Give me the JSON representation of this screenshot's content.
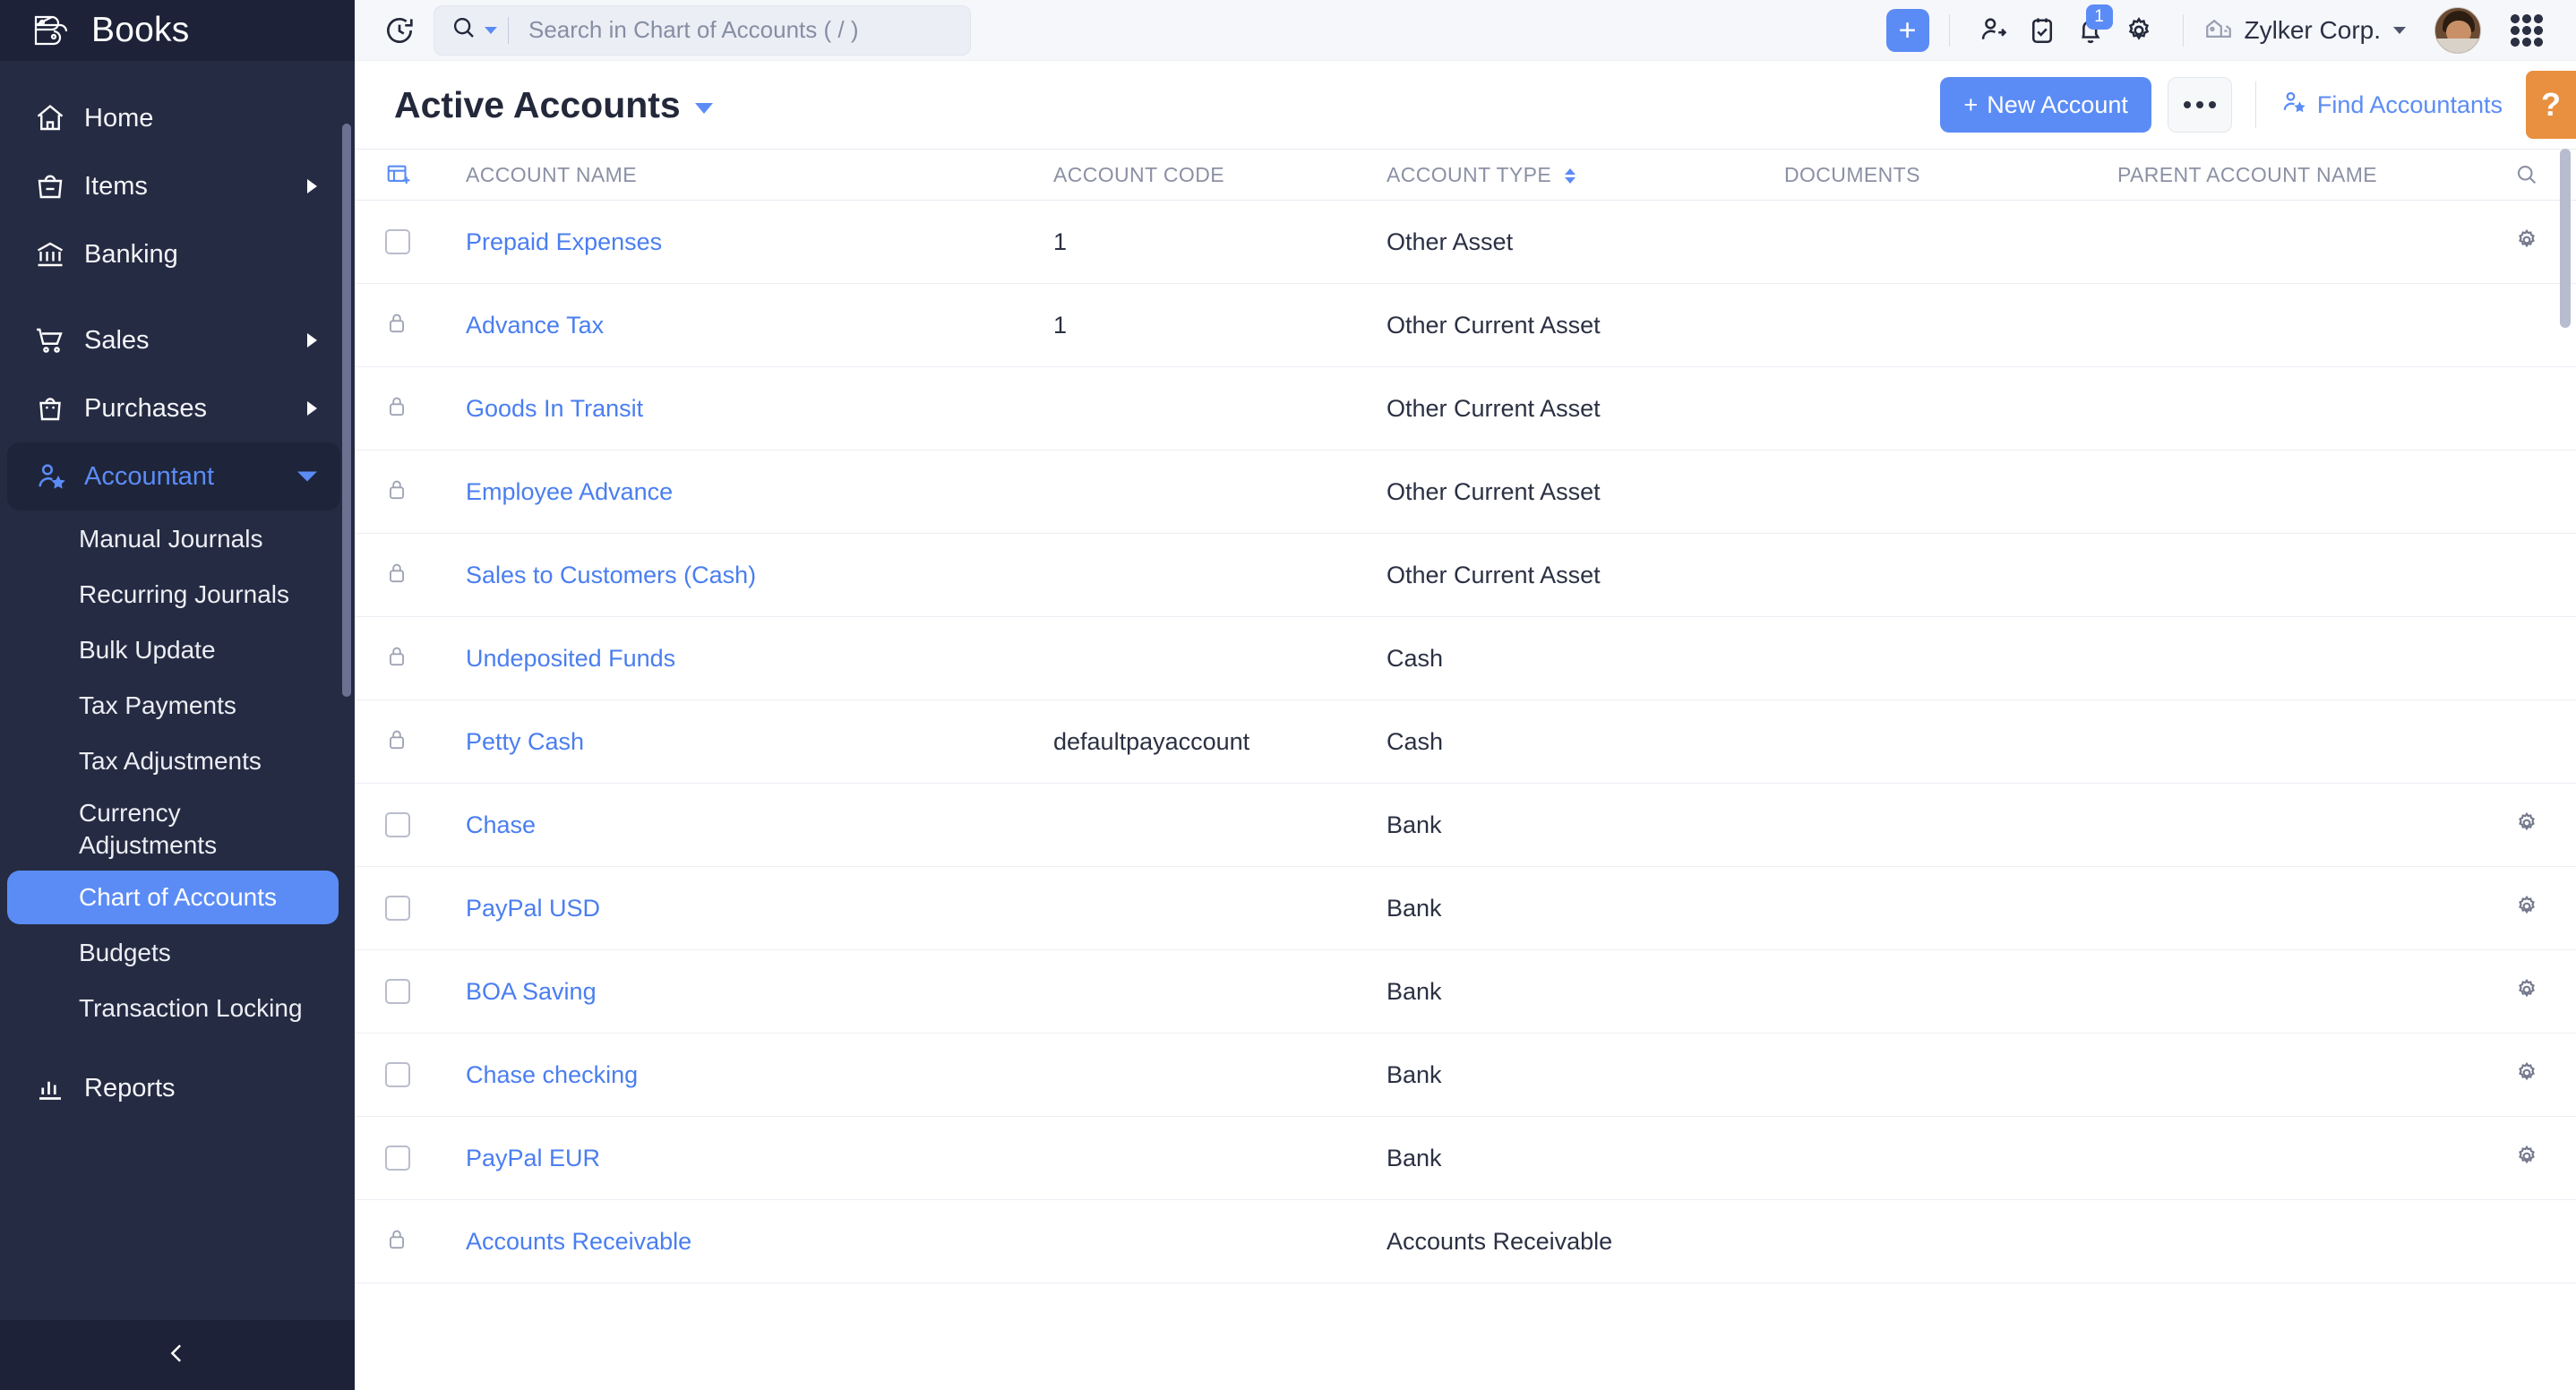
{
  "brand": {
    "name": "Books",
    "logo_icon": "books-logo-icon"
  },
  "sidebar": {
    "items": [
      {
        "label": "Home",
        "icon": "home-icon",
        "has_arrow": false
      },
      {
        "label": "Items",
        "icon": "bag-icon",
        "has_arrow": true
      },
      {
        "label": "Banking",
        "icon": "bank-icon",
        "has_arrow": false
      },
      {
        "label": "Sales",
        "icon": "cart-icon",
        "has_arrow": true
      },
      {
        "label": "Purchases",
        "icon": "purchase-bag-icon",
        "has_arrow": true
      },
      {
        "label": "Accountant",
        "icon": "accountant-icon",
        "has_arrow": true,
        "expanded": true,
        "active_color": "#5b8cf6"
      },
      {
        "label": "Reports",
        "icon": "reports-bar-chart-icon",
        "has_arrow": false
      }
    ],
    "accountant_subitems": [
      {
        "label": "Manual Journals",
        "active": false
      },
      {
        "label": "Recurring Journals",
        "active": false
      },
      {
        "label": "Bulk Update",
        "active": false
      },
      {
        "label": "Tax Payments",
        "active": false
      },
      {
        "label": "Tax Adjustments",
        "active": false
      },
      {
        "label": "Currency Adjustments",
        "active": false
      },
      {
        "label": "Chart of Accounts",
        "active": true
      },
      {
        "label": "Budgets",
        "active": false
      },
      {
        "label": "Transaction Locking",
        "active": false
      }
    ],
    "collapse_icon": "chevron-left-icon"
  },
  "topbar": {
    "refresh_icon": "refresh-clock-icon",
    "search": {
      "placeholder": "Search in Chart of Accounts ( / )",
      "value": "",
      "icon": "search-icon"
    },
    "add_label": "+",
    "icons": [
      {
        "name": "contacts-icon"
      },
      {
        "name": "tasks-clipboard-icon"
      },
      {
        "name": "notifications-bell-icon",
        "badge": "1"
      },
      {
        "name": "settings-gear-icon"
      }
    ],
    "org": {
      "name": "Zylker Corp.",
      "icon": "organization-home-icon"
    },
    "avatar_name": "user-avatar",
    "apps_icon": "apps-grid-icon"
  },
  "page": {
    "title": "Active Accounts",
    "new_account_label": "New Account",
    "new_account_plus": "+",
    "more_label": "•••",
    "find_accountants_label": "Find Accountants",
    "help_label": "?",
    "accent_color": "#5b8cf6",
    "help_color": "#e8903f"
  },
  "table": {
    "columns": [
      {
        "key": "select",
        "label": ""
      },
      {
        "key": "name",
        "label": "ACCOUNT NAME",
        "sortable": false
      },
      {
        "key": "code",
        "label": "ACCOUNT CODE",
        "sortable": false
      },
      {
        "key": "type",
        "label": "ACCOUNT TYPE",
        "sortable": true
      },
      {
        "key": "documents",
        "label": "DOCUMENTS",
        "sortable": false
      },
      {
        "key": "parent",
        "label": "PARENT ACCOUNT NAME",
        "sortable": false
      },
      {
        "key": "actions",
        "label": ""
      }
    ],
    "header_column_icon": "add-column-icon",
    "header_search_icon": "search-icon",
    "rows": [
      {
        "select": "checkbox",
        "name": "Prepaid Expenses",
        "code": "1",
        "type": "Other Asset",
        "documents": "",
        "parent": "",
        "action": "gear"
      },
      {
        "select": "lock",
        "name": "Advance Tax",
        "code": "1",
        "type": "Other Current Asset",
        "documents": "",
        "parent": "",
        "action": ""
      },
      {
        "select": "lock",
        "name": "Goods In Transit",
        "code": "",
        "type": "Other Current Asset",
        "documents": "",
        "parent": "",
        "action": ""
      },
      {
        "select": "lock",
        "name": "Employee Advance",
        "code": "",
        "type": "Other Current Asset",
        "documents": "",
        "parent": "",
        "action": ""
      },
      {
        "select": "lock",
        "name": "Sales to Customers (Cash)",
        "code": "",
        "type": "Other Current Asset",
        "documents": "",
        "parent": "",
        "action": ""
      },
      {
        "select": "lock",
        "name": "Undeposited Funds",
        "code": "",
        "type": "Cash",
        "documents": "",
        "parent": "",
        "action": ""
      },
      {
        "select": "lock",
        "name": "Petty Cash",
        "code": "defaultpayaccount",
        "type": "Cash",
        "documents": "",
        "parent": "",
        "action": ""
      },
      {
        "select": "checkbox",
        "name": "Chase",
        "code": "",
        "type": "Bank",
        "documents": "",
        "parent": "",
        "action": "gear"
      },
      {
        "select": "checkbox",
        "name": "PayPal USD",
        "code": "",
        "type": "Bank",
        "documents": "",
        "parent": "",
        "action": "gear"
      },
      {
        "select": "checkbox",
        "name": "BOA Saving",
        "code": "",
        "type": "Bank",
        "documents": "",
        "parent": "",
        "action": "gear"
      },
      {
        "select": "checkbox",
        "name": "Chase checking",
        "code": "",
        "type": "Bank",
        "documents": "",
        "parent": "",
        "action": "gear"
      },
      {
        "select": "checkbox",
        "name": "PayPal EUR",
        "code": "",
        "type": "Bank",
        "documents": "",
        "parent": "",
        "action": "gear"
      },
      {
        "select": "lock",
        "name": "Accounts Receivable",
        "code": "",
        "type": "Accounts Receivable",
        "documents": "",
        "parent": "",
        "action": ""
      }
    ]
  }
}
